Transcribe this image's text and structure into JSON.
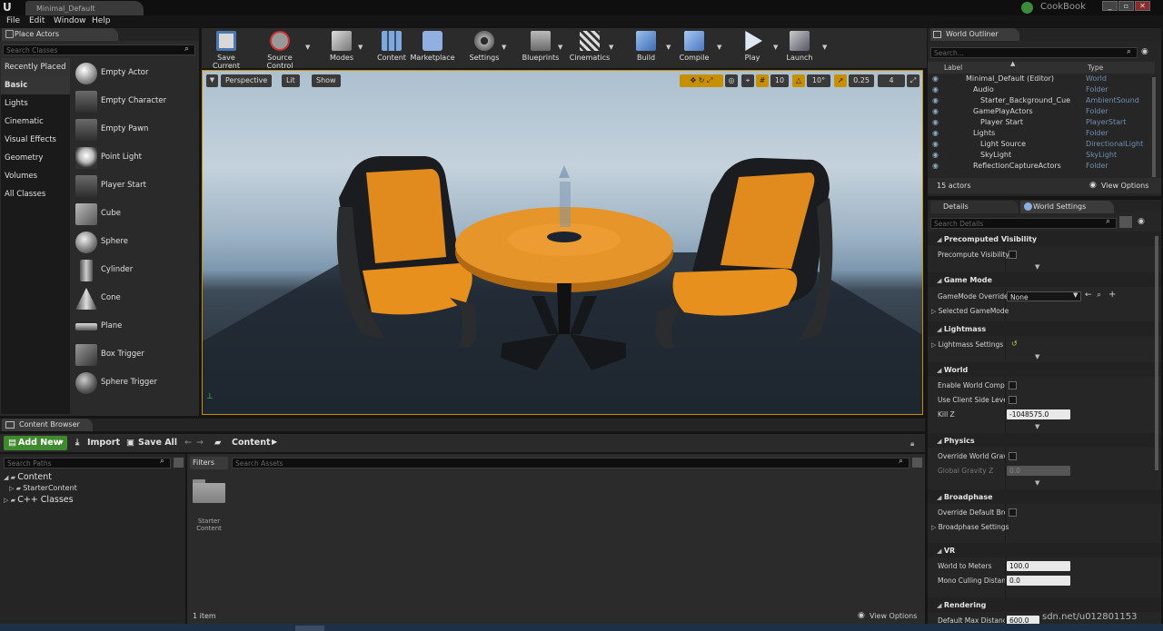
{
  "titlebar": {
    "doc_tab": "Minimal_Default",
    "project": "CookBook",
    "win": [
      "_",
      "▫",
      "✕"
    ]
  },
  "menu": [
    "File",
    "Edit",
    "Window",
    "Help"
  ],
  "place_actors": {
    "tab": "Place Actors",
    "search_placeholder": "Search Classes",
    "categories": [
      "Recently Placed",
      "Basic",
      "Lights",
      "Cinematic",
      "Visual Effects",
      "Geometry",
      "Volumes",
      "All Classes"
    ],
    "actors": [
      "Empty Actor",
      "Empty Character",
      "Empty Pawn",
      "Point Light",
      "Player Start",
      "Cube",
      "Sphere",
      "Cylinder",
      "Cone",
      "Plane",
      "Box Trigger",
      "Sphere Trigger"
    ]
  },
  "toolbar": [
    "Save Current",
    "Source Control",
    "Modes",
    "Content",
    "Marketplace",
    "Settings",
    "Blueprints",
    "Cinematics",
    "Build",
    "Compile",
    "Play",
    "Launch"
  ],
  "viewport": {
    "perspective": "Perspective",
    "lit": "Lit",
    "show": "Show",
    "grid": "10",
    "angle": "10°",
    "scale": "0.25",
    "cam": "4"
  },
  "outliner": {
    "tab": "World Outliner",
    "search_placeholder": "Search...",
    "col_label": "Label",
    "col_type": "Type",
    "rows": [
      {
        "label": "Minimal_Default (Editor)",
        "type": "World"
      },
      {
        "label": "Audio",
        "type": "Folder"
      },
      {
        "label": "Starter_Background_Cue",
        "type": "AmbientSound"
      },
      {
        "label": "GamePlayActors",
        "type": "Folder"
      },
      {
        "label": "Player Start",
        "type": "PlayerStart"
      },
      {
        "label": "Lights",
        "type": "Folder"
      },
      {
        "label": "Light Source",
        "type": "DirectionalLight"
      },
      {
        "label": "SkyLight",
        "type": "SkyLight"
      },
      {
        "label": "ReflectionCaptureActors",
        "type": "Folder"
      }
    ],
    "count": "15 actors",
    "view_options": "View Options"
  },
  "details": {
    "tab_details": "Details",
    "tab_world": "World Settings",
    "search_placeholder": "Search Details",
    "sections": {
      "precomputed": "Precomputed Visibility",
      "precompute_visibility": "Precompute Visibility",
      "game_mode": "Game Mode",
      "gamemode_override": "GameMode Override",
      "gamemode_value": "None",
      "selected_gamemode": "Selected GameMode",
      "lightmass": "Lightmass",
      "lightmass_settings": "Lightmass Settings",
      "world": "World",
      "enable_world_composition": "Enable World Composi",
      "use_client_side": "Use Client Side Level !",
      "kill_z": "Kill Z",
      "kill_z_value": "-1048575.0",
      "physics": "Physics",
      "override_world_gravity": "Override World Gravity",
      "global_gravity_z": "Global Gravity Z",
      "global_gravity_value": "0.0",
      "broadphase": "Broadphase",
      "override_default_broad": "Override Default Broad",
      "broadphase_settings": "Broadphase Settings",
      "vr": "VR",
      "world_to_meters": "World to Meters",
      "world_to_meters_value": "100.0",
      "mono_culling": "Mono Culling Distance",
      "mono_culling_value": "0.0",
      "rendering": "Rendering",
      "default_max_distance": "Default Max Distance",
      "default_max_value": "600.0"
    }
  },
  "content_browser": {
    "tab": "Content Browser",
    "add_new": "Add New",
    "import": "Import",
    "save_all": "Save All",
    "path": "Content",
    "search_paths": "Search Paths",
    "filters": "Filters",
    "search_assets": "Search Assets",
    "tree": [
      "Content",
      "StarterContent",
      "C++ Classes"
    ],
    "asset_line1": "Starter",
    "asset_line2": "Content",
    "item_count": "1 item",
    "view_options": "View Options"
  },
  "watermark": "sdn.net/u012801153",
  "colors": {
    "accent": "#c88f00",
    "add_new": "#3f8a2e",
    "seat": "#e8901e",
    "table": "#e6952a"
  }
}
